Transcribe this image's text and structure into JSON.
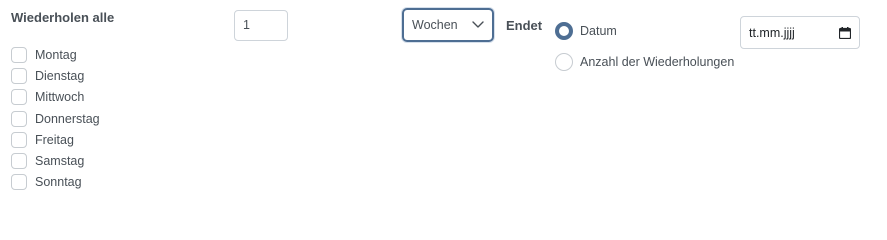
{
  "repeat": {
    "title": "Wiederholen alle",
    "days": [
      "Montag",
      "Dienstag",
      "Mittwoch",
      "Donnerstag",
      "Freitag",
      "Samstag",
      "Sonntag"
    ],
    "interval_value": "1",
    "unit_selected": "Wochen"
  },
  "ends": {
    "label": "Endet",
    "options": [
      "Datum",
      "Anzahl der Wiederholungen"
    ],
    "selected": "Datum",
    "date_placeholder": "tt.mm.jjjj"
  },
  "colors": {
    "accent": "#4e6e93",
    "text": "#495057",
    "border": "#ced4da"
  },
  "icons": {
    "unit_select": "chevron-down-icon",
    "date_picker": "calendar-icon"
  }
}
